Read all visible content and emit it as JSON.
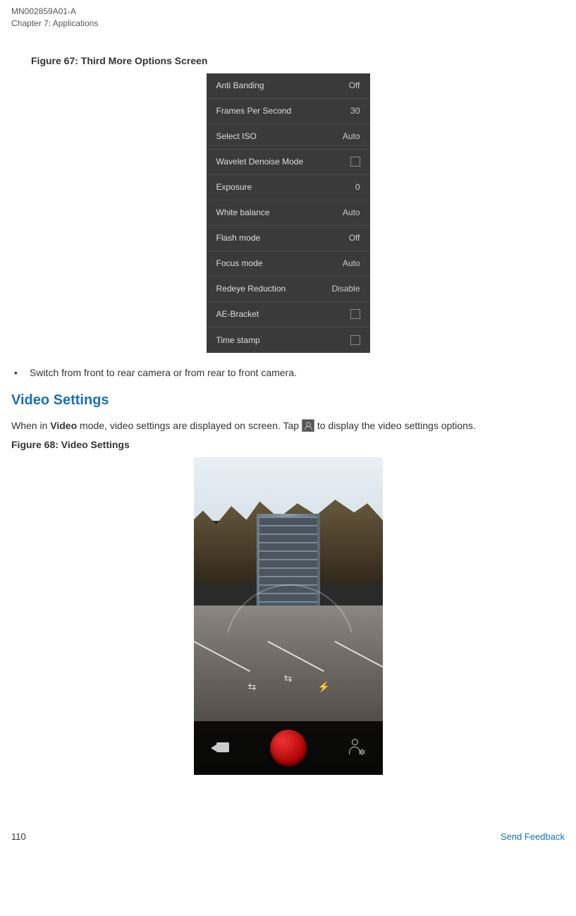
{
  "header": {
    "doc_id": "MN002859A01-A",
    "chapter": "Chapter 7:  Applications"
  },
  "figure67": {
    "caption": "Figure 67: Third More Options Screen",
    "rows": [
      {
        "label": "Anti Banding",
        "value": "Off",
        "checkbox": false
      },
      {
        "label": "Frames Per Second",
        "value": "30",
        "checkbox": false
      },
      {
        "label": "Select ISO",
        "value": "Auto",
        "checkbox": false
      },
      {
        "label": "Wavelet Denoise Mode",
        "value": "",
        "checkbox": true
      },
      {
        "label": "Exposure",
        "value": "0",
        "checkbox": false
      },
      {
        "label": "White balance",
        "value": "Auto",
        "checkbox": false
      },
      {
        "label": "Flash mode",
        "value": "Off",
        "checkbox": false
      },
      {
        "label": "Focus mode",
        "value": "Auto",
        "checkbox": false
      },
      {
        "label": "Redeye Reduction",
        "value": "Disable",
        "checkbox": false
      },
      {
        "label": "AE-Bracket",
        "value": "",
        "checkbox": true
      },
      {
        "label": "Time stamp",
        "value": "",
        "checkbox": true
      }
    ]
  },
  "bullet1": "Switch from front to rear camera or from rear to front camera.",
  "section_heading": "Video Settings",
  "video_text_parts": {
    "pre": "When in ",
    "bold": "Video",
    "mid": " mode, video settings are displayed on screen. Tap ",
    "post": " to display the video settings options."
  },
  "figure68": {
    "caption": "Figure 68: Video Settings"
  },
  "footer": {
    "page": "110",
    "feedback": "Send Feedback"
  }
}
